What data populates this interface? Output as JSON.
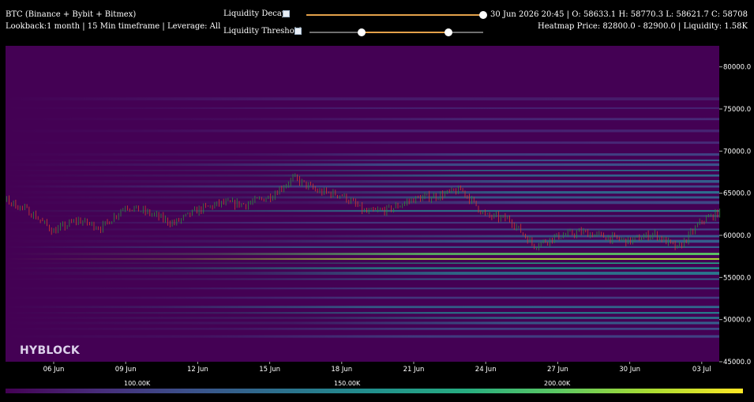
{
  "header": {
    "title": "BTC (Binance + Bybit + Bitmex)",
    "subtitle": "Lookback:1 month | 15 Min timeframe | Leverage: All",
    "ohlc": "30 Jun 2026 20:45 | O: 58633.1 H: 58770.3 L: 58621.7 C: 58708",
    "heatmap_info": "Heatmap Price: 82800.0 - 82900.0 | Liquidity: 1.58K"
  },
  "controls": {
    "decay_label": "Liquidity Decay",
    "threshold_label": "Liquidity Threshold",
    "decay_value": 1.0,
    "threshold_low": 0.3,
    "threshold_high": 0.8
  },
  "brand": "HYBLOCK",
  "colors": {
    "background": "#440154",
    "candle_up": "#2e8b3a",
    "candle_down": "#d23a2e",
    "slider_fill": "#e3a14a"
  },
  "colorbar": {
    "labels": [
      "100.00K",
      "150.00K",
      "200.00K"
    ]
  },
  "chart_data": {
    "type": "heatmap",
    "x": [
      "06 Jun",
      "09 Jun",
      "12 Jun",
      "15 Jun",
      "18 Jun",
      "21 Jun",
      "24 Jun",
      "27 Jun",
      "30 Jun",
      "03 Jul"
    ],
    "ylim": [
      45000,
      82500
    ],
    "yticks": [
      "45000.0",
      "50000.0",
      "55000.0",
      "60000.0",
      "65000.0",
      "70000.0",
      "75000.0",
      "80000.0"
    ],
    "price_series": {
      "days": [
        4,
        5,
        6,
        7,
        8,
        9,
        10,
        11,
        12,
        13,
        14,
        15,
        16,
        17,
        18,
        19,
        20,
        21,
        22,
        23,
        24,
        25,
        26,
        27,
        28,
        29,
        30,
        31,
        32,
        33,
        33.8
      ],
      "price": [
        64200,
        62800,
        60500,
        61800,
        60900,
        63500,
        62600,
        61400,
        63000,
        63800,
        63700,
        64600,
        66800,
        65200,
        64800,
        62700,
        63100,
        64300,
        64700,
        65400,
        62300,
        61900,
        58800,
        59900,
        60400,
        59800,
        59300,
        60200,
        58400,
        61700,
        62800
      ]
    },
    "liquidity_bands": [
      {
        "price": 76200,
        "intensity": 0.08
      },
      {
        "price": 75100,
        "intensity": 0.1
      },
      {
        "price": 73800,
        "intensity": 0.12
      },
      {
        "price": 72400,
        "intensity": 0.1
      },
      {
        "price": 71000,
        "intensity": 0.12
      },
      {
        "price": 69600,
        "intensity": 0.2
      },
      {
        "price": 68900,
        "intensity": 0.28
      },
      {
        "price": 68400,
        "intensity": 0.25
      },
      {
        "price": 67700,
        "intensity": 0.42
      },
      {
        "price": 67100,
        "intensity": 0.34
      },
      {
        "price": 66400,
        "intensity": 0.3
      },
      {
        "price": 65800,
        "intensity": 0.24
      },
      {
        "price": 65100,
        "intensity": 0.36
      },
      {
        "price": 64500,
        "intensity": 0.3
      },
      {
        "price": 63900,
        "intensity": 0.22
      },
      {
        "price": 62900,
        "intensity": 0.4
      },
      {
        "price": 62300,
        "intensity": 0.2
      },
      {
        "price": 61500,
        "intensity": 0.18
      },
      {
        "price": 60700,
        "intensity": 0.22
      },
      {
        "price": 59900,
        "intensity": 0.28
      },
      {
        "price": 59300,
        "intensity": 0.3
      },
      {
        "price": 58600,
        "intensity": 0.3
      },
      {
        "price": 57800,
        "intensity": 0.75
      },
      {
        "price": 57200,
        "intensity": 0.88
      },
      {
        "price": 56700,
        "intensity": 0.6
      },
      {
        "price": 56100,
        "intensity": 0.5
      },
      {
        "price": 55500,
        "intensity": 0.4
      },
      {
        "price": 54800,
        "intensity": 0.3
      },
      {
        "price": 53700,
        "intensity": 0.2
      },
      {
        "price": 52600,
        "intensity": 0.18
      },
      {
        "price": 51500,
        "intensity": 0.34
      },
      {
        "price": 50800,
        "intensity": 0.44
      },
      {
        "price": 50200,
        "intensity": 0.4
      },
      {
        "price": 49600,
        "intensity": 0.3
      },
      {
        "price": 48900,
        "intensity": 0.22
      },
      {
        "price": 48000,
        "intensity": 0.2
      }
    ]
  }
}
